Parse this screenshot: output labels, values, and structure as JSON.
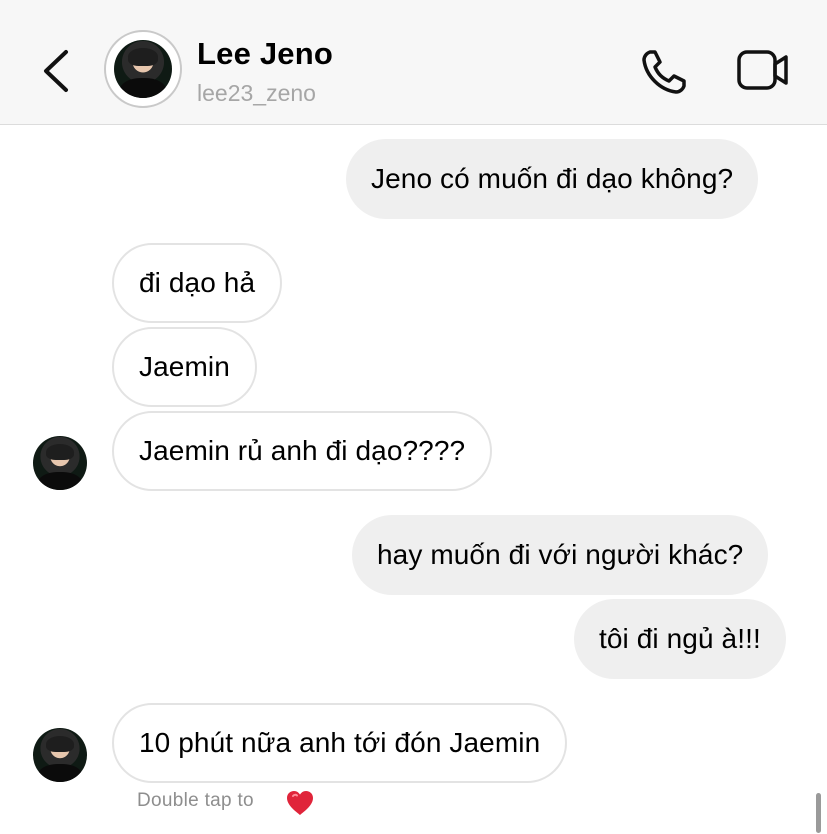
{
  "header": {
    "name": "Lee Jeno",
    "username": "lee23_zeno",
    "back_icon": "chevron-left-icon",
    "call_icon": "phone-icon",
    "video_icon": "video-camera-icon"
  },
  "messages": [
    {
      "direction": "outgoing",
      "text": "Jeno có muốn đi dạo không?"
    },
    {
      "direction": "incoming",
      "text": "đi dạo hả"
    },
    {
      "direction": "incoming",
      "text": "Jaemin"
    },
    {
      "direction": "incoming",
      "text": "Jaemin rủ anh đi dạo????"
    },
    {
      "direction": "outgoing",
      "text": "hay muốn đi với người khác?"
    },
    {
      "direction": "outgoing",
      "text": "tôi đi ngủ à!!!"
    },
    {
      "direction": "incoming",
      "text": "10 phút nữa anh tới đón Jaemin"
    }
  ],
  "reaction_hint": {
    "text": "Double tap to",
    "icon": "heart-icon",
    "heart_color": "#e0243a"
  },
  "colors": {
    "header_bg": "#f7f7f7",
    "outgoing_bubble": "#efefef",
    "incoming_border": "#e3e3e3",
    "secondary_text": "#a6a6a6"
  }
}
